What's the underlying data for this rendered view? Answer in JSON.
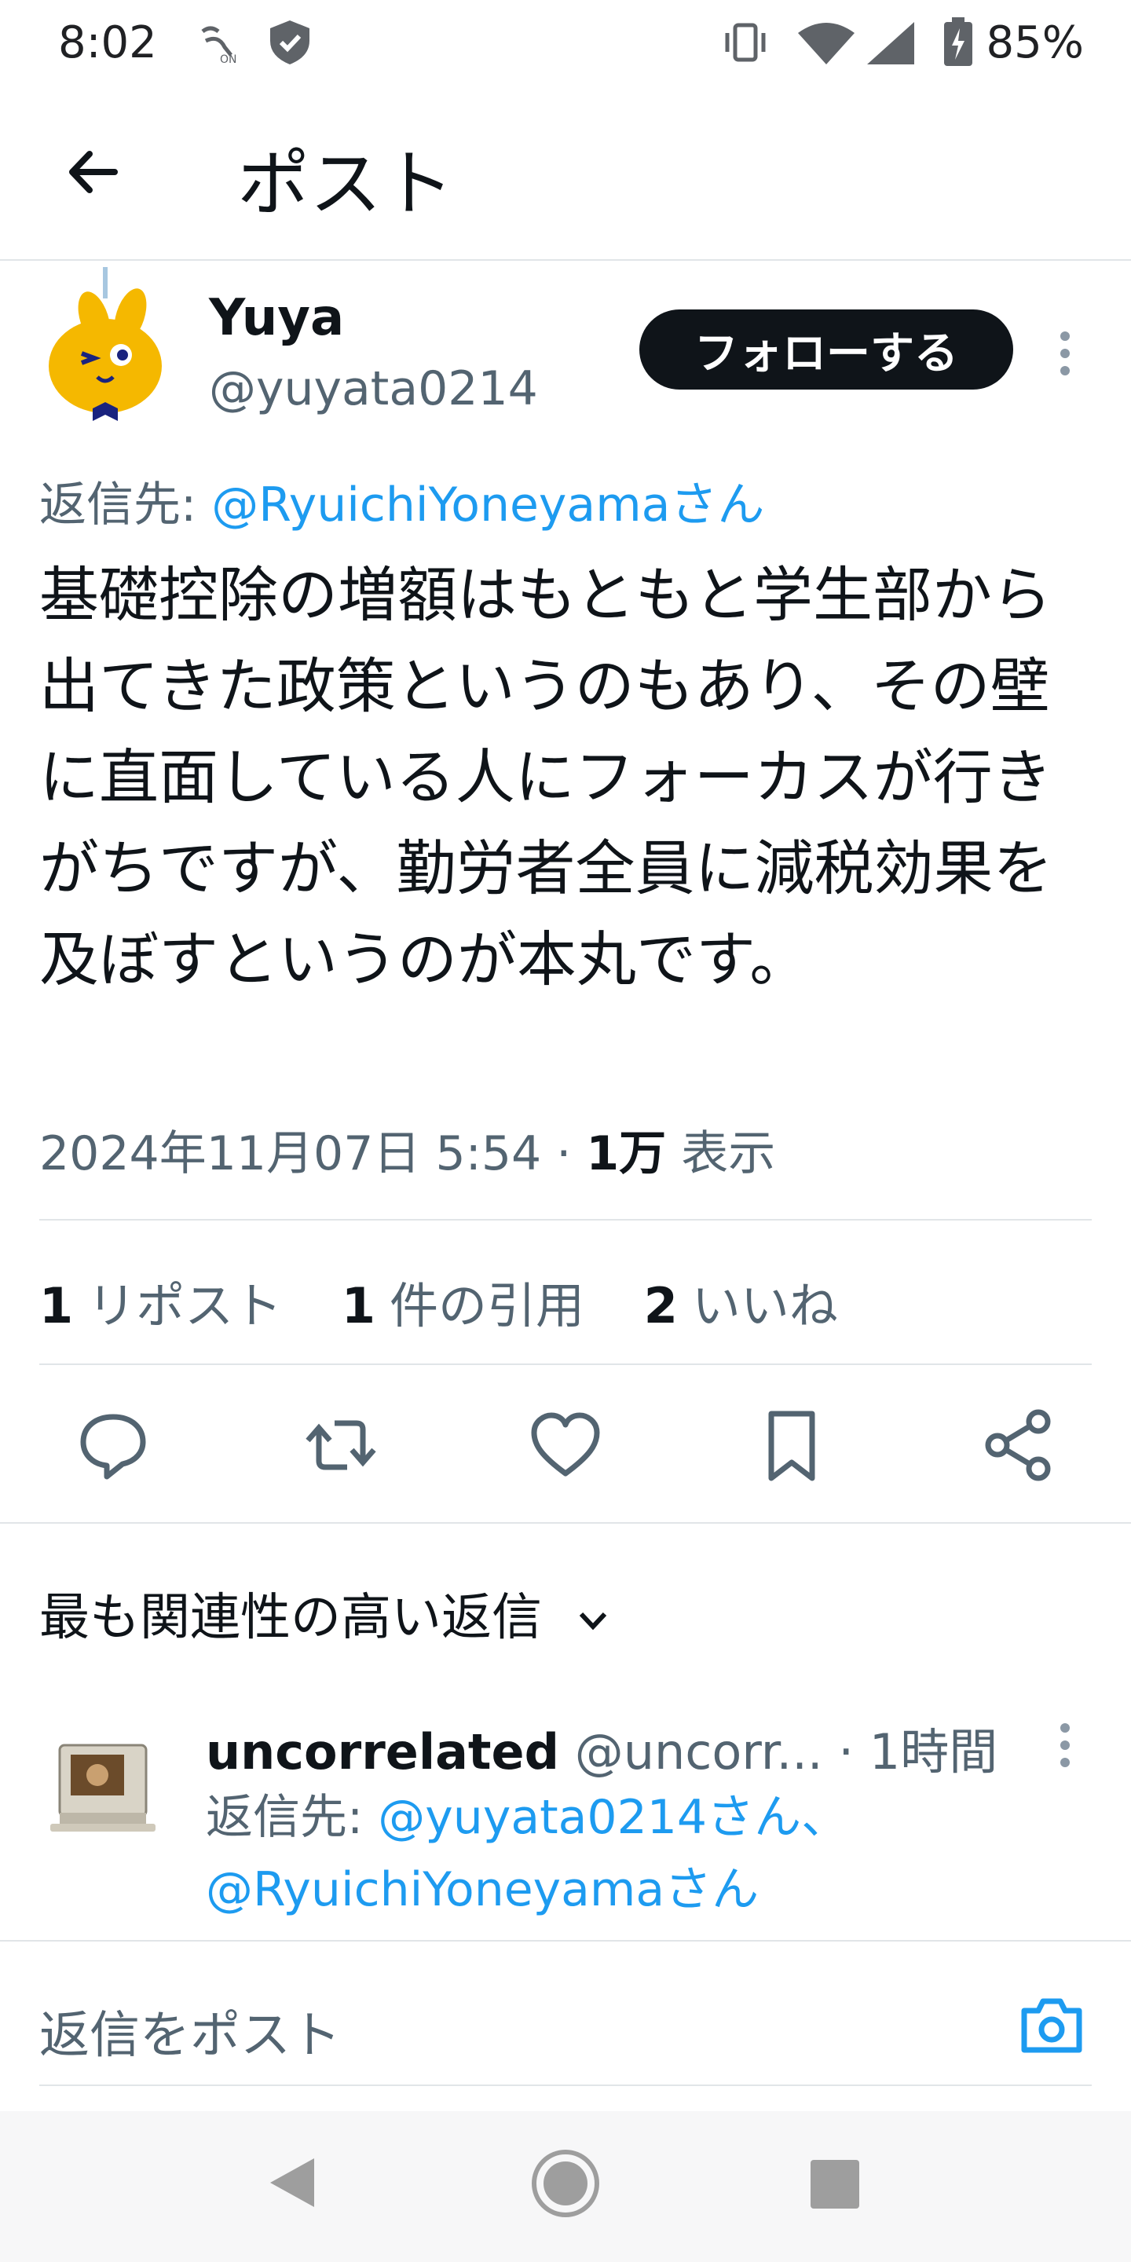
{
  "status_bar": {
    "time": "8:02",
    "nfc_label": "ON",
    "battery": "85%"
  },
  "header": {
    "title": "ポスト"
  },
  "tweet": {
    "author_name": "Yuya",
    "author_handle": "@yuyata0214",
    "follow_label": "フォローする",
    "reply_to_prefix": "返信先: ",
    "reply_to_user": "@RyuichiYoneyamaさん",
    "body": "基礎控除の増額はもともと学生部から出てきた政策というのもあり、その壁に直面している人にフォーカスが行きがちですが、勤労者全員に減税効果を及ぼすというのが本丸です。",
    "timestamp": "2024年11月07日 5:54",
    "separator": " · ",
    "views_count": "1万",
    "views_label": " 表示"
  },
  "stats": [
    {
      "count": "1",
      "label": "リポスト"
    },
    {
      "count": "1",
      "label": "件の引用"
    },
    {
      "count": "2",
      "label": "いいね"
    }
  ],
  "replies": {
    "sort_label": "最も関連性の高い返信",
    "items": [
      {
        "name": "uncorrelated",
        "handle": "@uncorr...",
        "time": "· 1時間",
        "reply_to_prefix": "返信先: ",
        "reply_to_user1": "@yuyata0214さん、",
        "reply_to_user2": "@RyuichiYoneyamaさん"
      }
    ]
  },
  "compose": {
    "placeholder": "返信をポスト"
  },
  "colors": {
    "accent": "#1d9bf0",
    "text": "#0f1419",
    "secondary": "#536471"
  }
}
